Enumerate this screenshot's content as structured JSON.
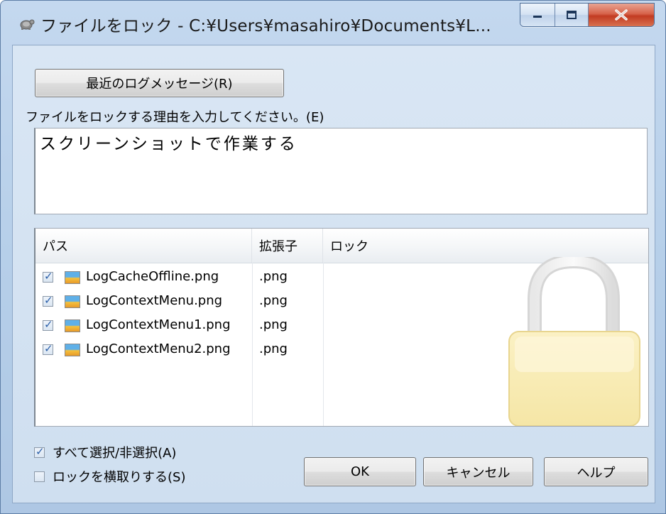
{
  "window": {
    "title": "ファイルをロック - C:¥Users¥masahiro¥Documents¥L...",
    "app_icon": "tortoise-icon",
    "caption_buttons": [
      "minimize-icon",
      "maximize-icon",
      "close-icon"
    ]
  },
  "recent_button_label": "最近のログメッセージ(R)",
  "reason": {
    "label": "ファイルをロックする理由を入力してください。(E)",
    "value": "スクリーンショットで作業する"
  },
  "list": {
    "columns": [
      "パス",
      "拡張子",
      "ロック"
    ],
    "rows": [
      {
        "checked": true,
        "path": "LogCacheOffline.png",
        "ext": ".png",
        "lock": ""
      },
      {
        "checked": true,
        "path": "LogContextMenu.png",
        "ext": ".png",
        "lock": ""
      },
      {
        "checked": true,
        "path": "LogContextMenu1.png",
        "ext": ".png",
        "lock": ""
      },
      {
        "checked": true,
        "path": "LogContextMenu2.png",
        "ext": ".png",
        "lock": ""
      }
    ],
    "watermark_icon": "padlock-icon"
  },
  "options": {
    "select_all_label": "すべて選択/非選択(A)",
    "select_all_checked": true,
    "steal_lock_label": "ロックを横取りする(S)",
    "steal_lock_checked": false
  },
  "buttons": {
    "ok": "OK",
    "cancel": "キャンセル",
    "help": "ヘルプ"
  },
  "colors": {
    "title_bar": "#b6cfe9",
    "close_button": "#c23b22",
    "check_mark": "#2a5ea8"
  }
}
